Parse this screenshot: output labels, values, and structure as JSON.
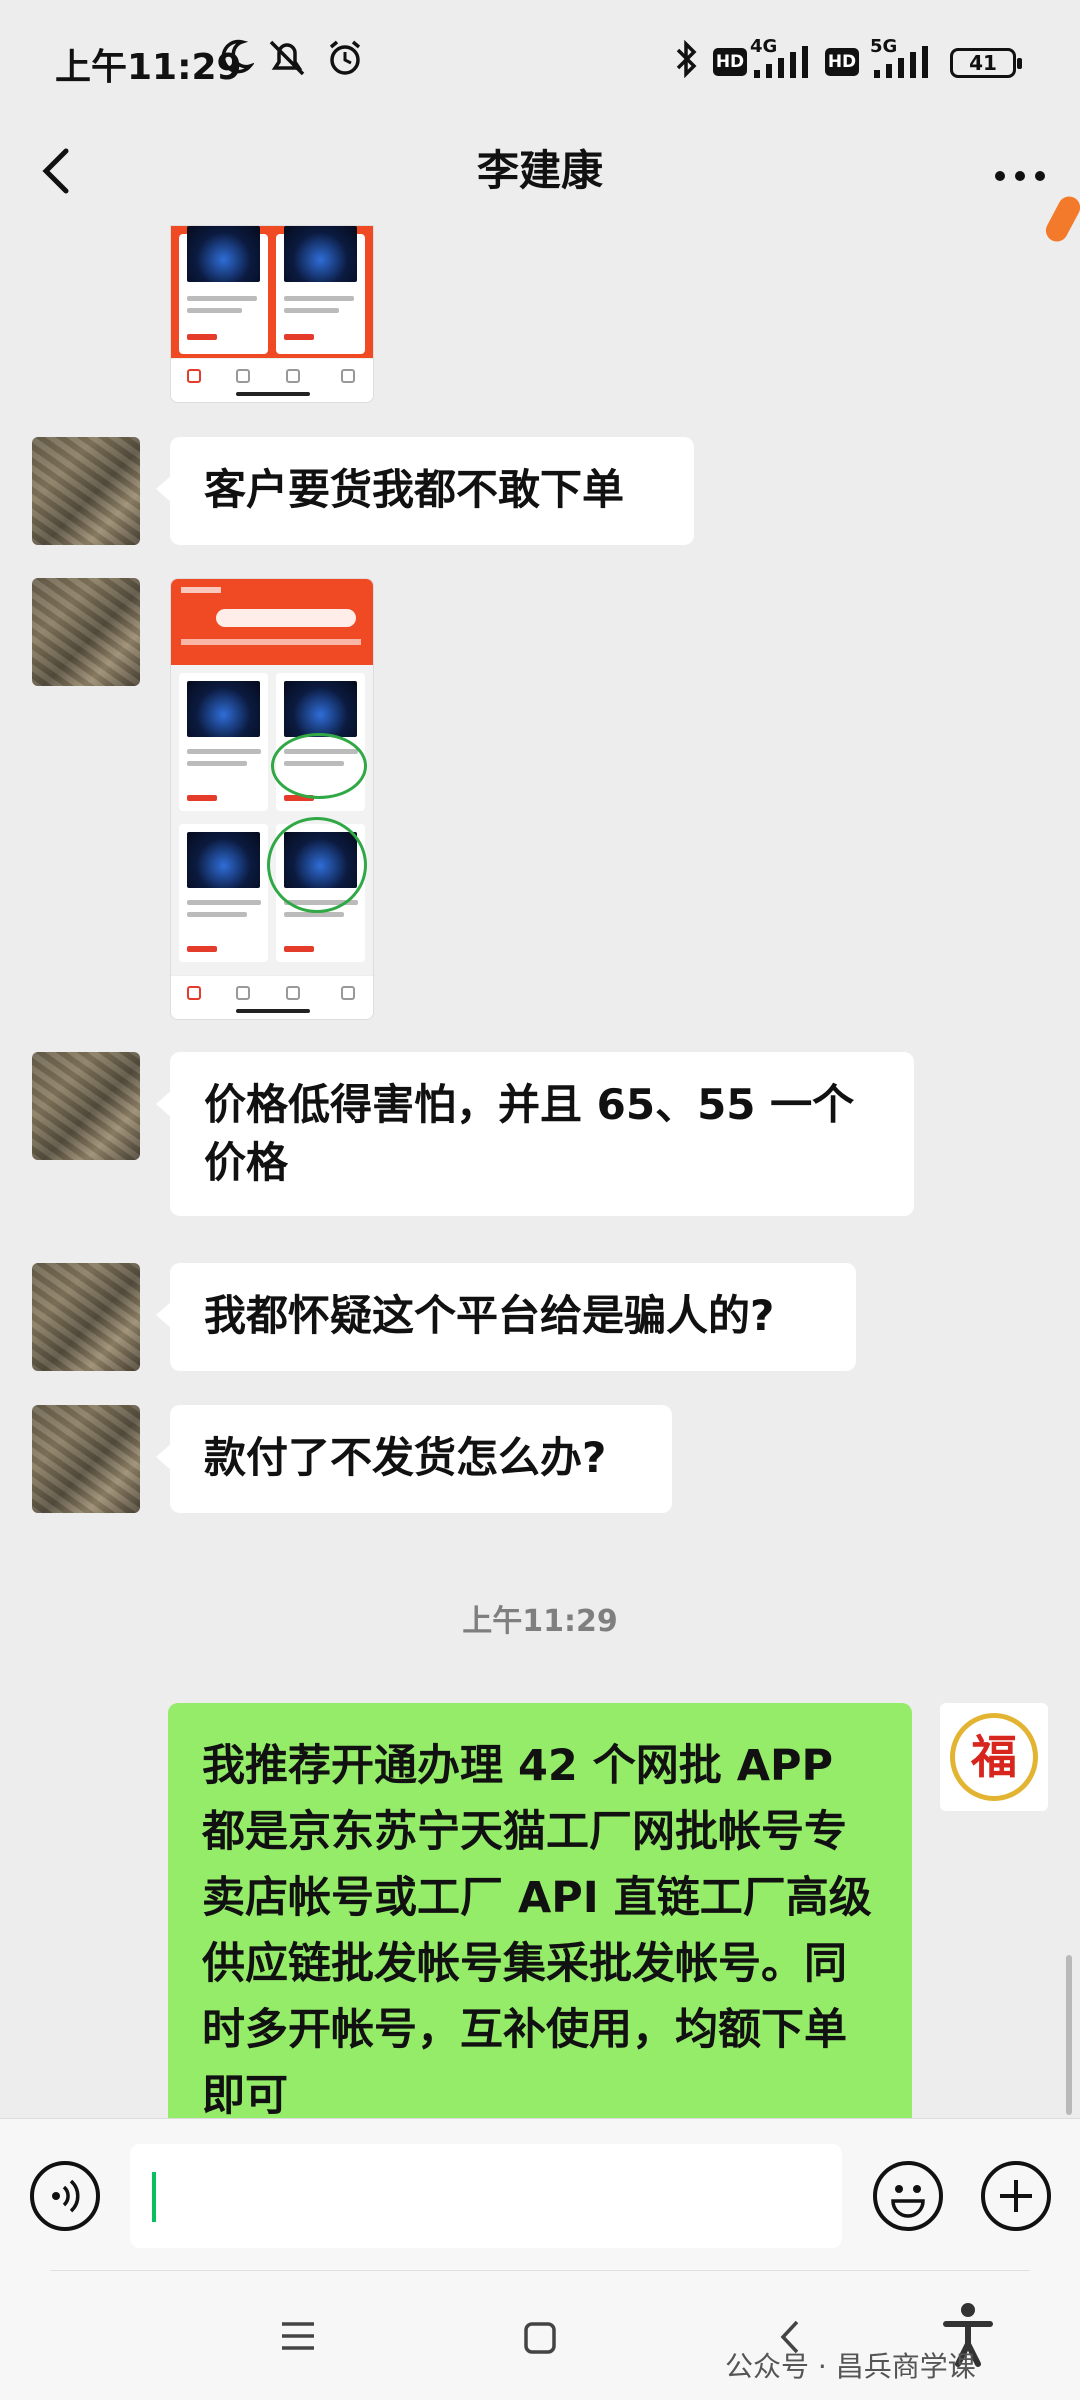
{
  "status_bar": {
    "time": "上午11:29",
    "network_1": "4G",
    "network_2": "5G",
    "hd_label": "HD",
    "battery": "41"
  },
  "header": {
    "title": "李建康"
  },
  "messages": [
    {
      "side": "left",
      "type": "image"
    },
    {
      "side": "left",
      "type": "text",
      "text": "客户要货我都不敢下单"
    },
    {
      "side": "left",
      "type": "image"
    },
    {
      "side": "left",
      "type": "text",
      "text": "价格低得害怕，并且 65、55 一个价格"
    },
    {
      "side": "left",
      "type": "text",
      "text": "我都怀疑这个平台给是骗人的?"
    },
    {
      "side": "left",
      "type": "text",
      "text": "款付了不发货怎么办?"
    },
    {
      "side": "right",
      "type": "text",
      "text": "我推荐开通办理 42 个网批 APP 都是京东苏宁天猫工厂网批帐号专卖店帐号或工厂 API 直链工厂高级供应链批发帐号集采批发帐号。同时多开帐号，互补使用，均额下单即可"
    }
  ],
  "timestamp": "上午11:29",
  "right_avatar": {
    "glyph": "福"
  },
  "watermark": "公众号 · 昌兵商学课",
  "colors": {
    "background": "#ededed",
    "bubble_left": "#ffffff",
    "bubble_right": "#95ec69",
    "caret": "#07c160"
  }
}
